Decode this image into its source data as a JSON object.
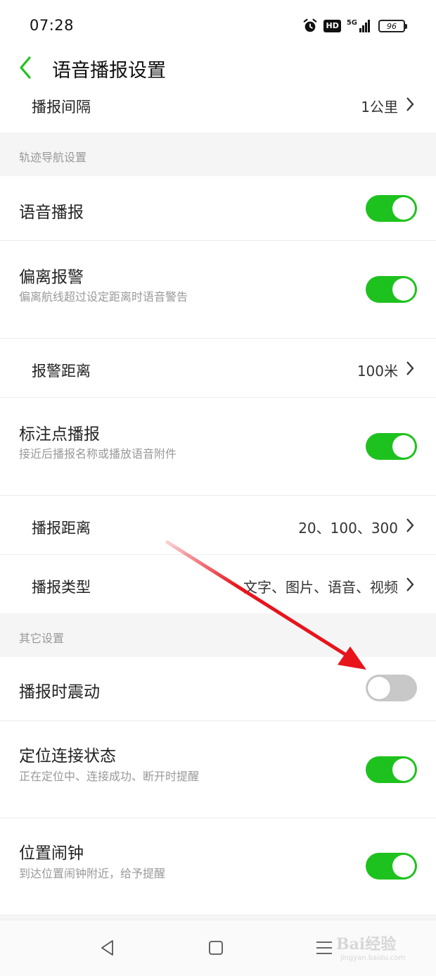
{
  "status_bar": {
    "time": "07:28",
    "network_badge": "HD",
    "network_type": "5G",
    "battery_level": "96"
  },
  "header": {
    "title": "语音播报设置"
  },
  "top_row": {
    "label": "播报间隔",
    "value": "1公里"
  },
  "sections": {
    "track_nav": "轨迹导航设置",
    "other": "其它设置"
  },
  "track_nav_items": {
    "voice_broadcast": {
      "label": "语音播报",
      "enabled": true
    },
    "deviation_alarm": {
      "label": "偏离报警",
      "sublabel": "偏离航线超过设定距离时语音警告",
      "enabled": true
    },
    "alarm_distance": {
      "label": "报警距离",
      "value": "100米"
    },
    "marker_broadcast": {
      "label": "标注点播报",
      "sublabel": "接近后播报名称或播放语音附件",
      "enabled": true
    },
    "broadcast_distance": {
      "label": "播报距离",
      "value": "20、100、300"
    },
    "broadcast_type": {
      "label": "播报类型",
      "value": "文字、图片、语音、视频"
    }
  },
  "other_items": {
    "vibrate": {
      "label": "播报时震动",
      "enabled": false
    },
    "location_status": {
      "label": "定位连接状态",
      "sublabel": "正在定位中、连接成功、断开时提醒",
      "enabled": true
    },
    "location_alarm": {
      "label": "位置闹钟",
      "sublabel": "到达位置闹钟附近，给予提醒",
      "enabled": true
    }
  },
  "watermark": {
    "text": "Bai经验",
    "sub": "jingyan.baidu.com"
  },
  "colors": {
    "accent_green": "#1ec21e",
    "toggle_off": "#c8c8c8",
    "annotation_red": "#e8141c"
  }
}
